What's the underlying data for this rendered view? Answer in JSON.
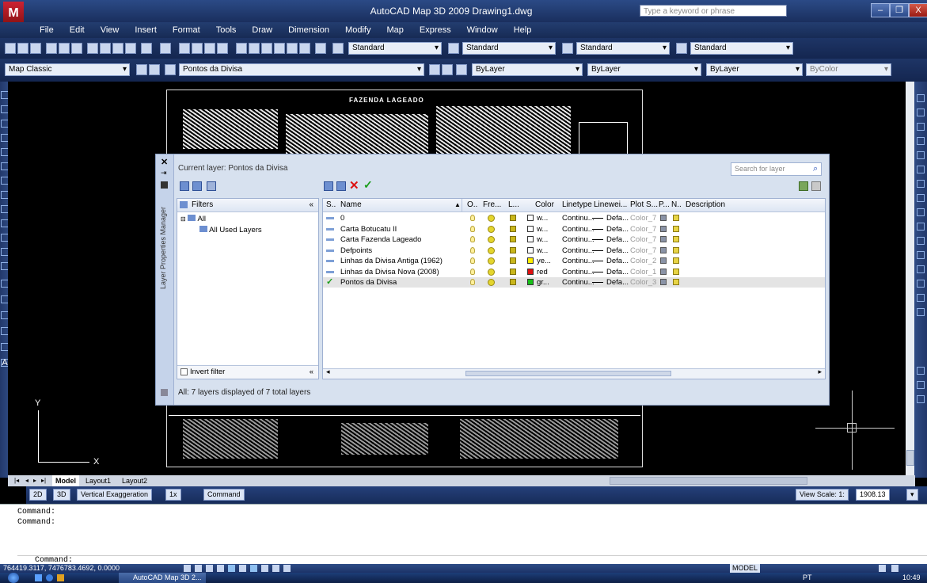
{
  "window": {
    "title": "AutoCAD Map 3D 2009  Drawing1.dwg",
    "search_placeholder": "Type a keyword or phrase",
    "minimize": "–",
    "restore": "❐",
    "close": "X"
  },
  "app_logo": "M",
  "menu": [
    "File",
    "Edit",
    "View",
    "Insert",
    "Format",
    "Tools",
    "Draw",
    "Dimension",
    "Modify",
    "Map",
    "Express",
    "Window",
    "Help"
  ],
  "toolbar1": {
    "text_style": "Standard",
    "dim_style": "Standard",
    "table_style": "Standard",
    "multileader_style": "Standard"
  },
  "toolbar2": {
    "workspace": "Map Classic",
    "layer": "Pontos da Divisa",
    "color": "ByLayer",
    "linetype": "ByLayer",
    "lineweight": "ByLayer",
    "plotstyle": "ByColor"
  },
  "drawing": {
    "title_block": "FAZENDA LAGEADO"
  },
  "ucs": {
    "x": "X",
    "y": "Y"
  },
  "layer_manager": {
    "palette_title": "Layer Properties Manager",
    "current_layer_label": "Current layer: Pontos da Divisa",
    "search_placeholder": "Search for layer",
    "filters_header": "Filters",
    "collapse_glyph": "«",
    "tree": [
      {
        "label": "All",
        "level": 0
      },
      {
        "label": "All Used Layers",
        "level": 1
      }
    ],
    "invert_filter": "Invert filter",
    "columns": [
      "S..",
      "Name",
      "O..",
      "Fre...",
      "L...",
      "Color",
      "Linetype",
      "Linewei...",
      "Plot S...",
      "P...",
      "N..",
      "Description"
    ],
    "rows": [
      {
        "name": "0",
        "color_name": "w...",
        "color_hex": "#ffffff",
        "linetype": "Continu...",
        "lineweight": "Defa...",
        "plot_style": "Color_7",
        "current": false,
        "selected": false
      },
      {
        "name": "Carta Botucatu II",
        "color_name": "w...",
        "color_hex": "#ffffff",
        "linetype": "Continu...",
        "lineweight": "Defa...",
        "plot_style": "Color_7",
        "current": false,
        "selected": false
      },
      {
        "name": "Carta Fazenda Lageado",
        "color_name": "w...",
        "color_hex": "#ffffff",
        "linetype": "Continu...",
        "lineweight": "Defa...",
        "plot_style": "Color_7",
        "current": false,
        "selected": false
      },
      {
        "name": "Defpoints",
        "color_name": "w...",
        "color_hex": "#ffffff",
        "linetype": "Continu...",
        "lineweight": "Defa...",
        "plot_style": "Color_7",
        "current": false,
        "selected": false
      },
      {
        "name": "Linhas da Divisa Antiga (1962)",
        "color_name": "ye...",
        "color_hex": "#ffee00",
        "linetype": "Continu...",
        "lineweight": "Defa...",
        "plot_style": "Color_2",
        "current": false,
        "selected": false
      },
      {
        "name": "Linhas da Divisa Nova (2008)",
        "color_name": "red",
        "color_hex": "#e01010",
        "linetype": "Continu...",
        "lineweight": "Defa...",
        "plot_style": "Color_1",
        "current": false,
        "selected": false
      },
      {
        "name": "Pontos da Divisa",
        "color_name": "gr...",
        "color_hex": "#18c018",
        "linetype": "Continu...",
        "lineweight": "Defa...",
        "plot_style": "Color_3",
        "current": true,
        "selected": true
      }
    ],
    "status": "All: 7 layers displayed of 7 total layers"
  },
  "tabs": [
    "Model",
    "Layout1",
    "Layout2"
  ],
  "view_strip": {
    "btn_2d": "2D",
    "btn_3d": "3D",
    "vertical_exaggeration": "Vertical Exaggeration",
    "ve_value": "1x",
    "command_btn": "Command",
    "view_scale_label": "View Scale: 1:",
    "view_scale_value": "1908.13"
  },
  "command_line": {
    "lines": [
      "Command:",
      "Command:"
    ],
    "prompt": "Command:"
  },
  "status_bar": {
    "coordinates": "764419.3117, 7476783.4692, 0.0000",
    "model": "MODEL"
  },
  "taskbar": {
    "task": "AutoCAD Map 3D 2...",
    "lang": "PT",
    "clock": "10:49"
  }
}
